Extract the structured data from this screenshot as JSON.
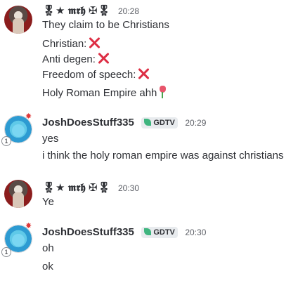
{
  "messages": [
    {
      "author": "🎖★ 𝖒𝖗𝖍 ✠🎖",
      "time": "20:28",
      "lines": [
        "They claim to be Christians",
        "Christian:",
        "Anti degen:",
        "Freedom of speech:",
        "Holy Roman Empire ahh"
      ],
      "emojis": [
        "cross-mark",
        "cross-mark",
        "cross-mark",
        "tulip"
      ]
    },
    {
      "author": "JoshDoesStuff335",
      "tag": "GDTV",
      "time": "20:29",
      "badge": "1",
      "lines": [
        "yes",
        "i think the holy roman empire was against christians"
      ]
    },
    {
      "author": "🎖★ 𝖒𝖗𝖍 ✠🎖",
      "time": "20:30",
      "lines": [
        "Ye"
      ]
    },
    {
      "author": "JoshDoesStuff335",
      "tag": "GDTV",
      "time": "20:30",
      "badge": "1",
      "lines": [
        "oh",
        "ok"
      ]
    }
  ],
  "colors": {
    "background": "#ffffff",
    "text": "#2e3035",
    "timestamp": "#5c5f66",
    "cross": "#dd2e44",
    "tag_bg": "#e8ebee",
    "leaf": "#3fb57f"
  }
}
